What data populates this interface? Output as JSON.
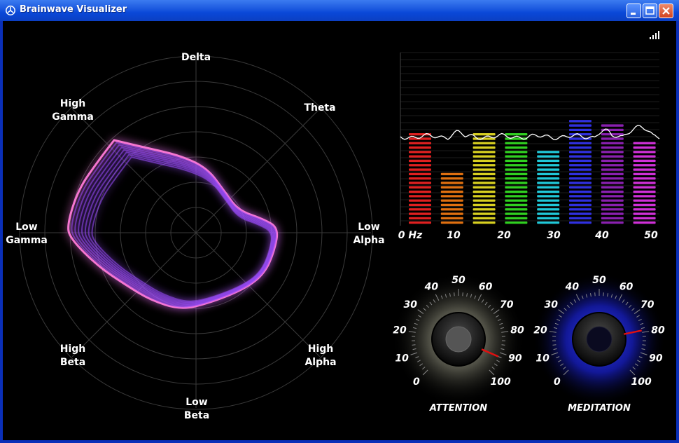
{
  "window": {
    "title": "Brainwave Visualizer",
    "icon": "unity-logo-icon"
  },
  "titlebar_buttons": [
    "minimize-icon",
    "maximize-icon",
    "close-icon"
  ],
  "status": {
    "icon": "signal-strength-icon"
  },
  "radar": {
    "axes": [
      {
        "l1": "Delta",
        "l2": ""
      },
      {
        "l1": "Theta",
        "l2": ""
      },
      {
        "l1": "Low",
        "l2": "Alpha"
      },
      {
        "l1": "High",
        "l2": "Alpha"
      },
      {
        "l1": "Low",
        "l2": "Beta"
      },
      {
        "l1": "High",
        "l2": "Beta"
      },
      {
        "l1": "Low",
        "l2": "Gamma"
      },
      {
        "l1": "High",
        "l2": "Gamma"
      }
    ],
    "shape_color": "#9a4dff",
    "highlight_color": "#ff7ad8"
  },
  "spectrum": {
    "x_ticks": [
      "0 Hz",
      "10",
      "20",
      "30",
      "40",
      "50"
    ],
    "bar_values": [
      0.73,
      0.4,
      0.73,
      0.73,
      0.58,
      0.83,
      0.77,
      0.63
    ],
    "bar_colors": [
      "#e02020",
      "#e07010",
      "#d8d020",
      "#30d020",
      "#20c8d8",
      "#3030e0",
      "#8a20b0",
      "#d030d8"
    ]
  },
  "gauges": [
    {
      "name": "ATTENTION",
      "value": 92,
      "ticks": [
        "0",
        "10",
        "20",
        "30",
        "40",
        "50",
        "60",
        "70",
        "80",
        "90",
        "100"
      ],
      "glow": "#b8b8a0"
    },
    {
      "name": "MEDITATION",
      "value": 79,
      "ticks": [
        "0",
        "10",
        "20",
        "30",
        "40",
        "50",
        "60",
        "70",
        "80",
        "90",
        "100"
      ],
      "glow": "#1a2cff"
    }
  ]
}
